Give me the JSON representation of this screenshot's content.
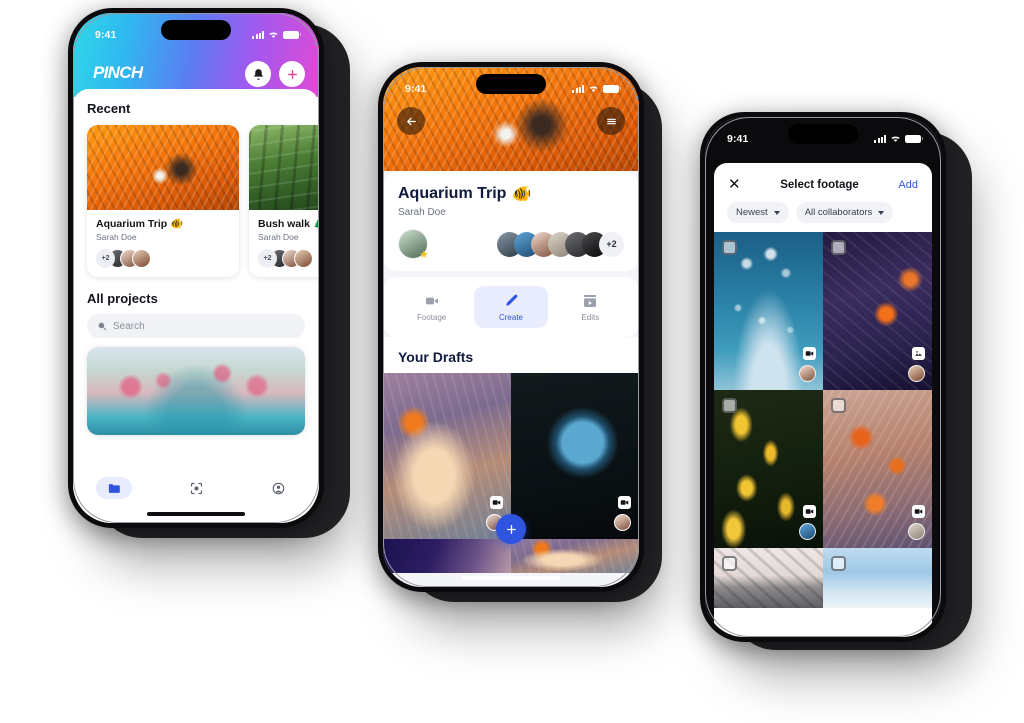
{
  "app": {
    "name": "PINCH",
    "accent": "#2F55E0"
  },
  "phone1": {
    "status": {
      "time": "9:41"
    },
    "header": {
      "logo": "PINCH",
      "bell_icon": "bell-icon",
      "add_icon": "plus-icon"
    },
    "recent": {
      "title": "Recent",
      "projects": [
        {
          "name": "Aquarium Trip",
          "emoji": "🐠",
          "owner": "Sarah Doe",
          "extra": "+2"
        },
        {
          "name": "Bush walk",
          "emoji": "🌲",
          "owner": "Sarah Doe",
          "extra": "+2"
        }
      ]
    },
    "all_projects": {
      "title": "All projects",
      "search_placeholder": "Search",
      "search_value": "",
      "search_icon": "search-icon"
    },
    "tabbar": [
      {
        "name": "projects",
        "icon": "folder-icon",
        "active": true
      },
      {
        "name": "capture",
        "icon": "capture-icon",
        "active": false
      },
      {
        "name": "profile",
        "icon": "person-icon",
        "active": false
      }
    ]
  },
  "phone2": {
    "status": {
      "time": "9:41"
    },
    "hero": {
      "back_icon": "arrow-left-icon",
      "menu_icon": "hamburger-icon"
    },
    "project": {
      "title": "Aquarium Trip",
      "emoji": "🐠",
      "owner": "Sarah Doe",
      "collaborators_more": "+2"
    },
    "tabs": [
      {
        "label": "Footage",
        "icon": "video-camera-icon",
        "active": false
      },
      {
        "label": "Create",
        "icon": "pen-icon",
        "active": true
      },
      {
        "label": "Edits",
        "icon": "film-icon",
        "active": false
      }
    ],
    "drafts": {
      "title": "Your Drafts"
    },
    "fab_icon": "plus-icon"
  },
  "phone3": {
    "status": {
      "time": "9:41"
    },
    "header": {
      "close_icon": "close-icon",
      "title": "Select footage",
      "add_label": "Add"
    },
    "filters": [
      {
        "label": "Newest",
        "icon": "chevron-down-icon"
      },
      {
        "label": "All collaborators",
        "icon": "chevron-down-icon"
      }
    ],
    "grid": [
      {
        "style": "ph-jelly",
        "checked": false,
        "video": true,
        "avatar": "a3"
      },
      {
        "style": "ph-reefdark",
        "checked": false,
        "video": true,
        "avatar": "a8"
      },
      {
        "style": "ph-yellowfish",
        "checked": false,
        "video": true,
        "avatar": "a2"
      },
      {
        "style": "ph-reeforange",
        "checked": false,
        "video": true,
        "avatar": "a4"
      },
      {
        "style": "ph-rock",
        "checked": false,
        "video": false,
        "avatar": ""
      },
      {
        "style": "ph-sky",
        "checked": false,
        "video": false,
        "avatar": ""
      }
    ]
  }
}
